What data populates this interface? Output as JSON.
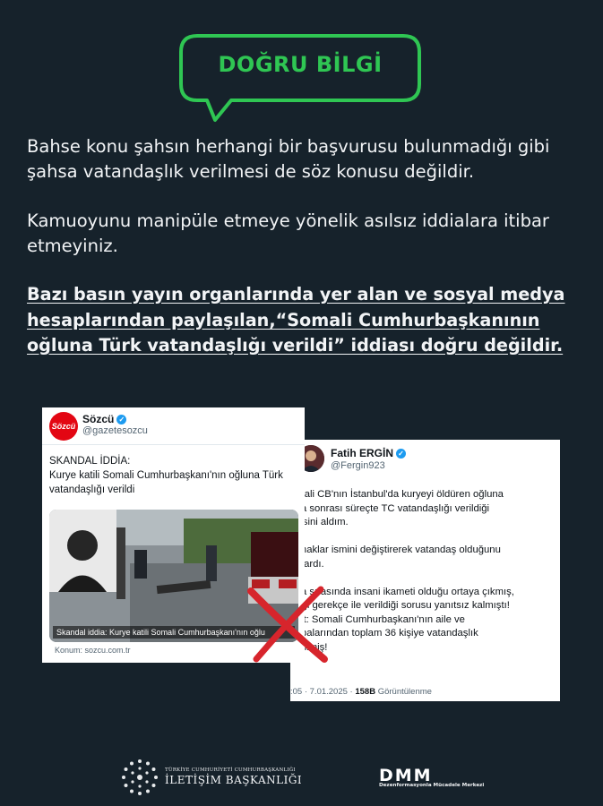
{
  "badge": {
    "label": "DOĞRU BİLGİ",
    "color": "#2fc653"
  },
  "paragraphs": {
    "p1": "Bahse konu şahsın herhangi bir başvurusu bulunmadığı gibi şahsa vatandaşlık verilmesi de söz konusu değildir.",
    "p2": "Kamuoyunu manipüle etmeye yönelik asılsız iddialara itibar etmeyiniz.",
    "p3": "Bazı basın yayın organlarında yer alan ve sosyal medya hesaplarından paylaşılan,“Somali Cumhurbaşkanının oğluna Türk vatandaşlığı verildi” iddiası doğru değildir."
  },
  "tweet_left": {
    "logo": "Sözcü",
    "name": "Sözcü",
    "handle": "@gazetesozcu",
    "text": "SKANDAL İDDİA:\nKurye katili Somali Cumhurbaşkanı'nın oğluna Türk vatandaşlığı verildi",
    "image_caption": "Skandal iddia: Kurye katili Somali Cumhurbaşkanı'nın oğlu",
    "source": "Konum: sozcu.com.tr"
  },
  "tweet_right": {
    "name": "Fatih ERGİN",
    "handle": "@Fergin923",
    "text": "omali CB'nın İstanbul'da kuryeyi öldüren oğluna\naza sonrası süreçte TC vatandaşlığı verildiği\nilgisini aldım.\n\naynaklar ismini değiştirerek vatandaş olduğunu\naktardı.\n\naza sırasında insani ikameti olduğu ortaya çıkmış,\nangi gerekçe ile verildiği sorusu yanıtsız kalmıştı!\nNot: Somali Cumhurbaşkanı'nın aile ve\nkabalarından toplam 36 kişiye vatandaşlık\nverilmiş!",
    "meta_time": ":05 · 7.01.2025 · ",
    "views": "158B",
    "views_label": " Görüntülenme"
  },
  "cross": {
    "color": "#d7252c",
    "icon": "x-mark-icon"
  },
  "footer": {
    "org_small": "TÜRKİYE CUMHURİYETİ CUMHURBAŞKANLIĞI",
    "org_main": "İLETİŞİM BAŞKANLIĞI",
    "dmm": "DMM",
    "dmm_sub": "Dezenformasyonla Mücadele Merkezi"
  }
}
